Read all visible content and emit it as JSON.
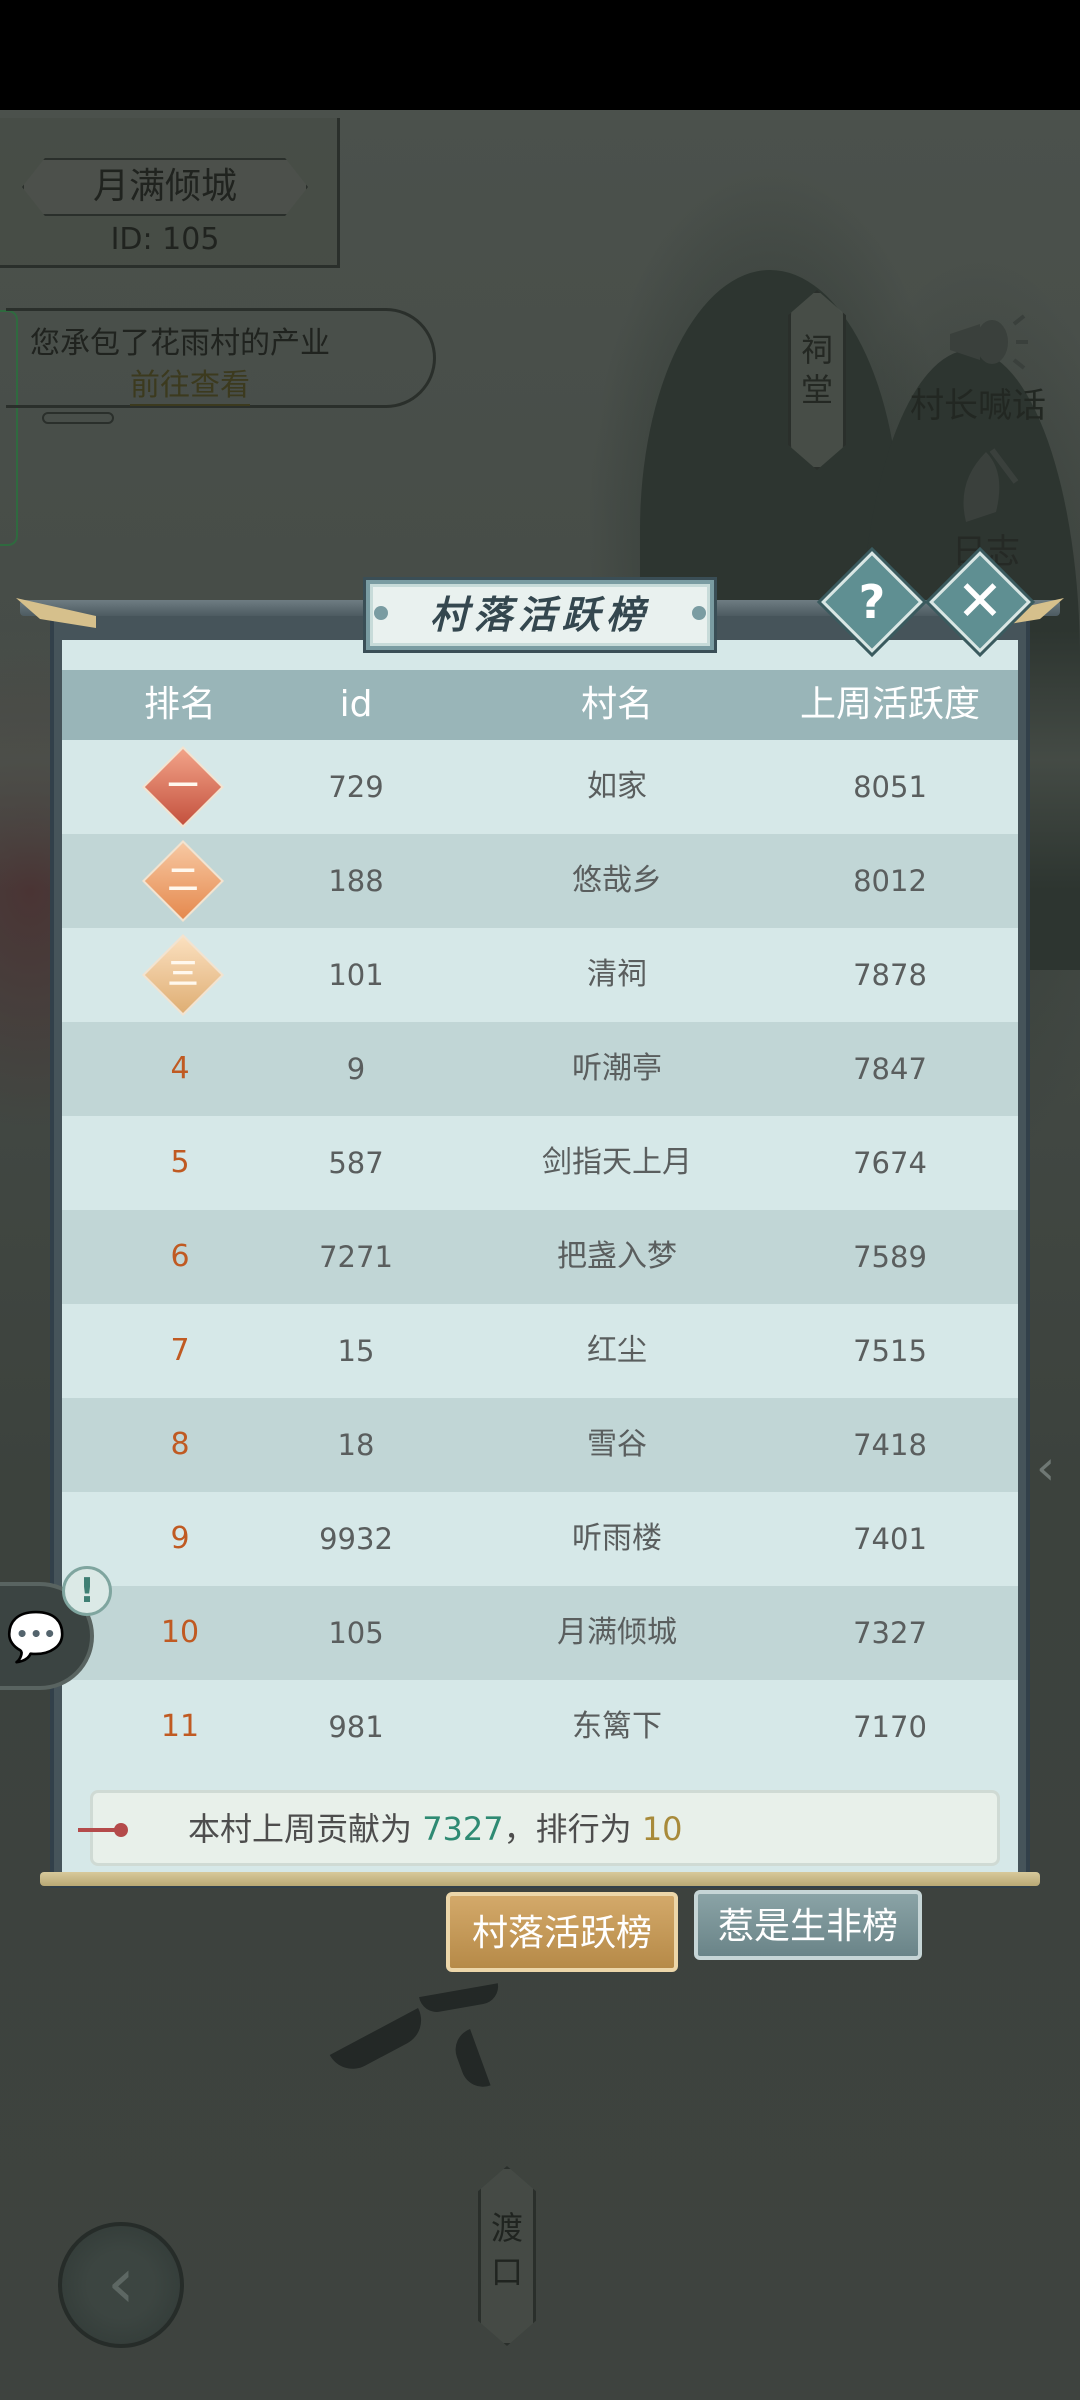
{
  "village": {
    "name": "月满倾城",
    "id_text": "ID: 105"
  },
  "notice": {
    "text": "您承包了花雨村的产业",
    "link": "前往查看"
  },
  "side_buttons": {
    "shrine": "祠\n堂",
    "chief_shout": "村长喊话",
    "log": "日志",
    "ferry": "渡\n口"
  },
  "panel": {
    "title": "村落活跃榜",
    "help_label": "?",
    "close_label": "✕",
    "headers": {
      "rank": "排名",
      "id": "id",
      "name": "村名",
      "activity": "上周活跃度"
    },
    "medal_glyphs": [
      "一",
      "二",
      "三"
    ],
    "rows": [
      {
        "rank": "1",
        "id": "729",
        "name": "如家",
        "activity": "8051"
      },
      {
        "rank": "2",
        "id": "188",
        "name": "悠哉乡",
        "activity": "8012"
      },
      {
        "rank": "3",
        "id": "101",
        "name": "清祠",
        "activity": "7878"
      },
      {
        "rank": "4",
        "id": "9",
        "name": "听潮亭",
        "activity": "7847"
      },
      {
        "rank": "5",
        "id": "587",
        "name": "剑指天上月",
        "activity": "7674"
      },
      {
        "rank": "6",
        "id": "7271",
        "name": "把盏入梦",
        "activity": "7589"
      },
      {
        "rank": "7",
        "id": "15",
        "name": "红尘",
        "activity": "7515"
      },
      {
        "rank": "8",
        "id": "18",
        "name": "雪谷",
        "activity": "7418"
      },
      {
        "rank": "9",
        "id": "9932",
        "name": "听雨楼",
        "activity": "7401"
      },
      {
        "rank": "10",
        "id": "105",
        "name": "月满倾城",
        "activity": "7327"
      },
      {
        "rank": "11",
        "id": "981",
        "name": "东篱下",
        "activity": "7170"
      }
    ],
    "summary": {
      "prefix": "本村上周贡献为",
      "contribution": "7327",
      "middle": "，排行为",
      "rank": "10"
    }
  },
  "tabs": {
    "active": "村落活跃榜",
    "inactive": "惹是生非榜"
  },
  "colors": {
    "rank_text": "#c05a22",
    "contribution": "#2e8a73",
    "rank_value": "#a88a3a",
    "tab_active": "#c69a5a"
  }
}
